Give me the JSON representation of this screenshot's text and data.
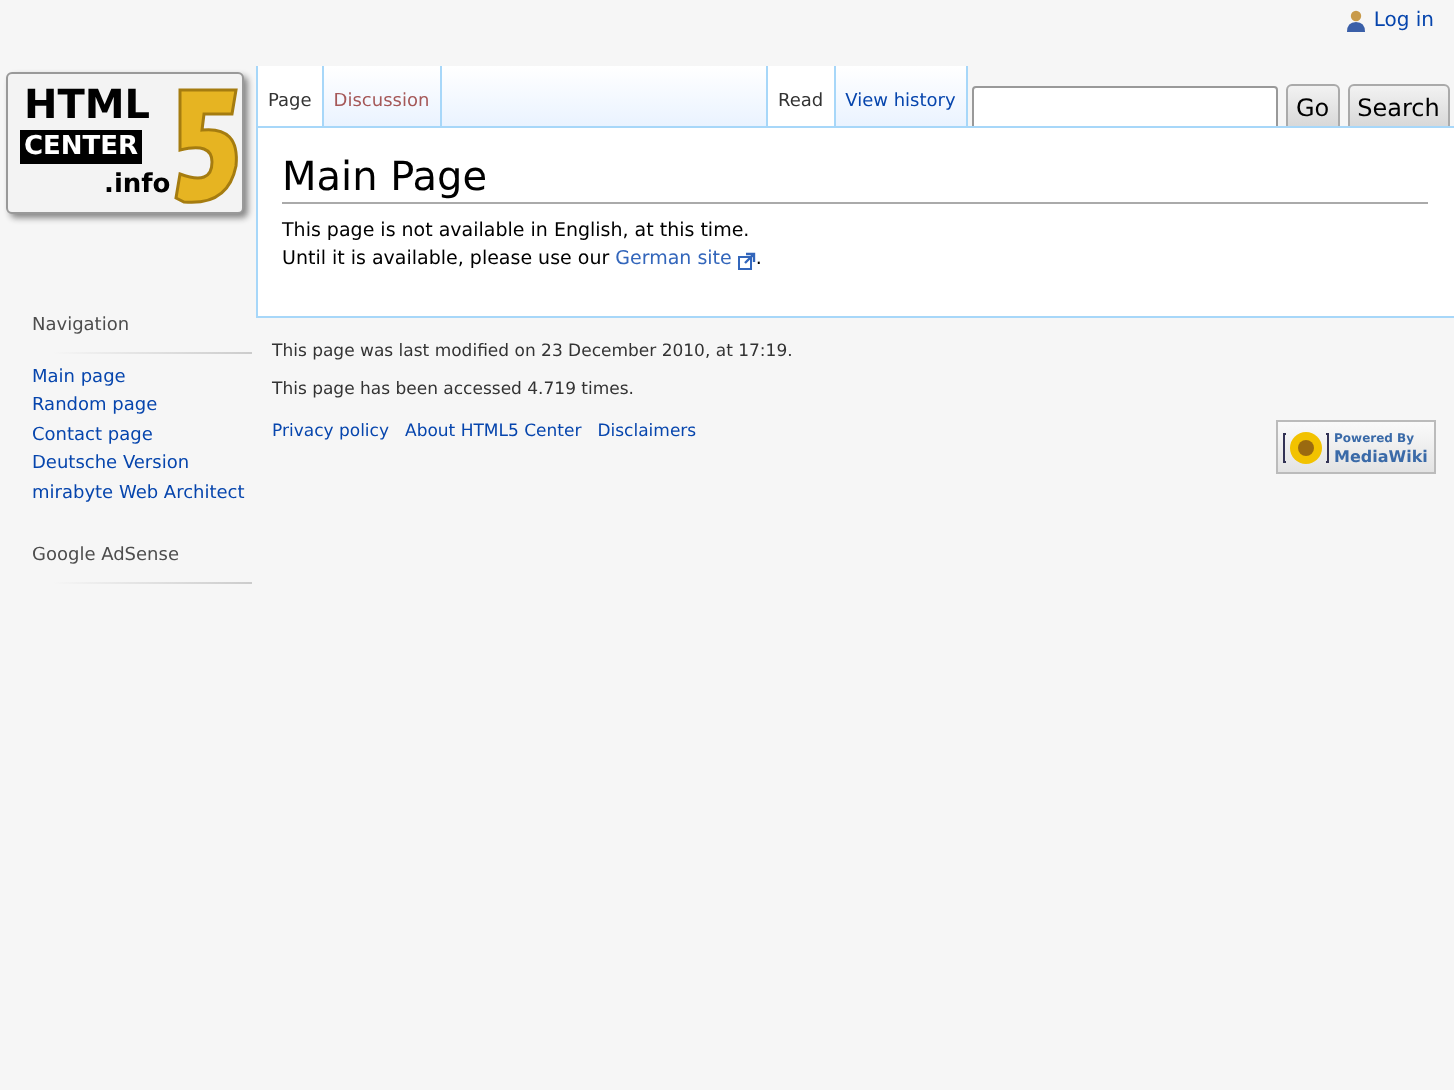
{
  "personal_tools": [
    {
      "label": "Log in"
    }
  ],
  "logo": {
    "lines": [
      "HTML",
      "CENTER",
      ".info"
    ]
  },
  "left_tabs": [
    {
      "label": "Page",
      "selected": true,
      "kind": "exists"
    },
    {
      "label": "Discussion",
      "selected": false,
      "kind": "missing"
    }
  ],
  "right_tabs": [
    {
      "label": "Read",
      "selected": true
    },
    {
      "label": "View history",
      "selected": false
    }
  ],
  "search": {
    "buttons": [
      "Go",
      "Search"
    ]
  },
  "page": {
    "title": "Main Page",
    "lines": [
      "This page is not available in English, at this time.",
      "Until it is available, please use our "
    ],
    "link": "German site",
    "after_link": "."
  },
  "sidebar": [
    {
      "heading": "Navigation",
      "items": [
        "Main page",
        "Random page",
        "Contact page",
        "Deutsche Version",
        "mirabyte Web Architect"
      ]
    },
    {
      "heading": "Google AdSense"
    }
  ],
  "footer": {
    "info": [
      "This page was last modified on 23 December 2010, at 17:19.",
      "This page has been accessed 4.719 times."
    ],
    "links": [
      "Privacy policy",
      "About HTML5 Center",
      "Disclaimers"
    ],
    "badge": [
      "Powered By",
      "MediaWiki"
    ]
  }
}
